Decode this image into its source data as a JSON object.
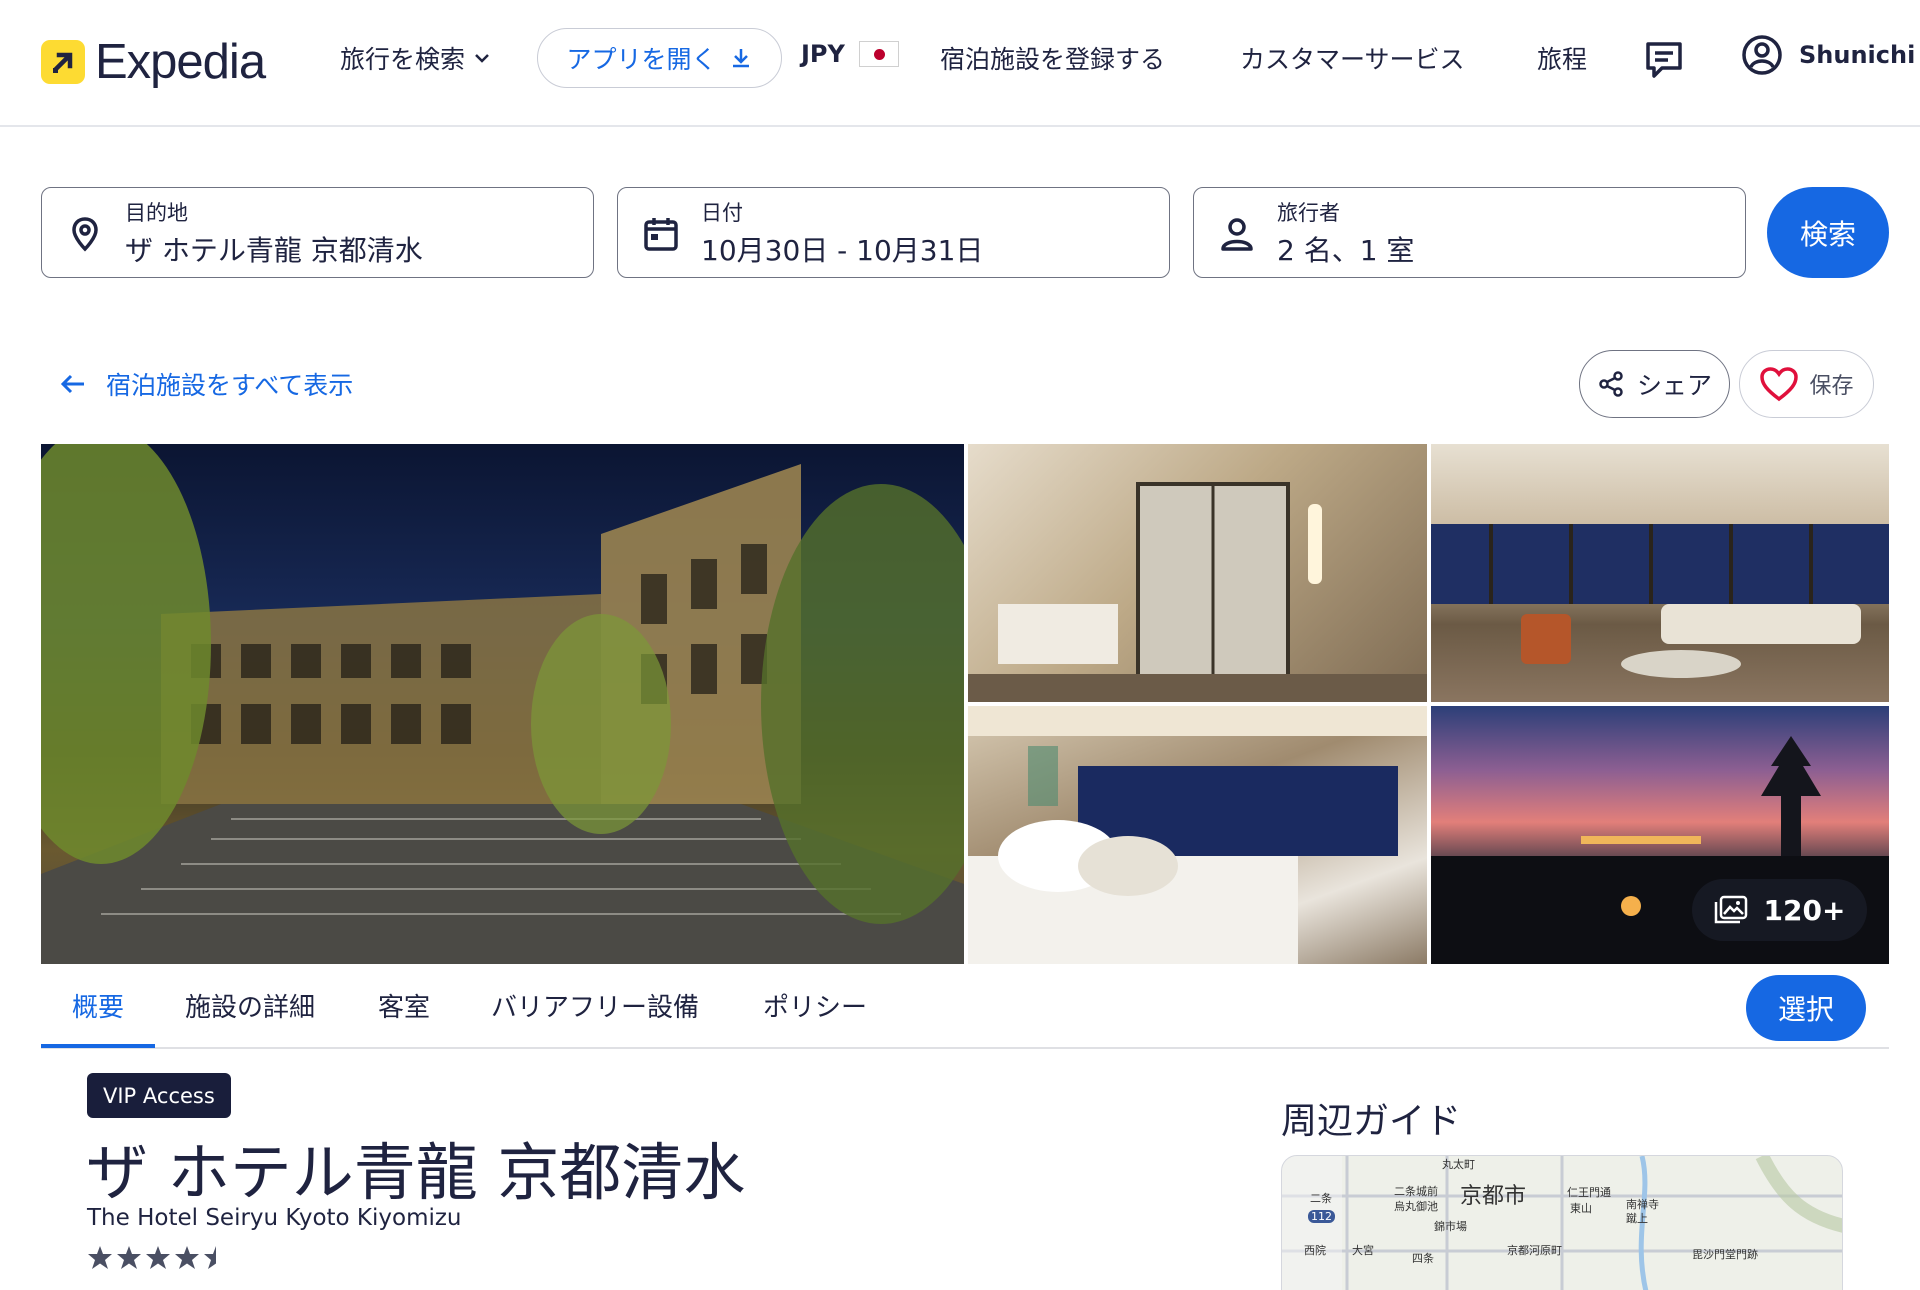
{
  "header": {
    "brand": "Expedia",
    "nav_search": "旅行を検索",
    "open_app": "アプリを開く",
    "currency": "JPY",
    "list_property": "宿泊施設を登録する",
    "customer_service": "カスタマーサービス",
    "trips": "旅程",
    "user_name": "Shunichi"
  },
  "search": {
    "destination_label": "目的地",
    "destination_value": "ザ ホテル青龍 京都清水",
    "dates_label": "日付",
    "dates_value": "10月30日 - 10月31日",
    "travelers_label": "旅行者",
    "travelers_value": "2 名、1 室",
    "search_button": "検索"
  },
  "actions": {
    "back_link": "宿泊施設をすべて表示",
    "share": "シェア",
    "save": "保存"
  },
  "gallery": {
    "more_count": "120+"
  },
  "tabs": [
    {
      "label": "概要",
      "active": true
    },
    {
      "label": "施設の詳細",
      "active": false
    },
    {
      "label": "客室",
      "active": false
    },
    {
      "label": "バリアフリー設備",
      "active": false
    },
    {
      "label": "ポリシー",
      "active": false
    }
  ],
  "select_button": "選択",
  "property": {
    "badge": "VIP Access",
    "name_ja": "ザ ホテル青龍 京都清水",
    "name_en": "The Hotel Seiryu Kyoto Kiyomizu",
    "star_rating": 4.5
  },
  "area_guide": {
    "title": "周辺ガイド",
    "map_labels": {
      "city": "京都市",
      "l1": "丸太町",
      "l2": "二条",
      "l3": "二条城前",
      "l4": "烏丸御池",
      "l5": "仁王門通",
      "l6": "東山",
      "l7": "南禅寺",
      "l8": "蹴上",
      "l9": "錦市場",
      "l10": "西院",
      "l11": "大宮",
      "l12": "四条",
      "l13": "京都河原町",
      "l14": "毘沙門堂門跡",
      "route": "112"
    }
  },
  "colors": {
    "accent": "#1668e3",
    "brand_yellow": "#fddb32",
    "text": "#1f2340",
    "badge_bg": "#191e3b",
    "heart": "#e0103c"
  }
}
